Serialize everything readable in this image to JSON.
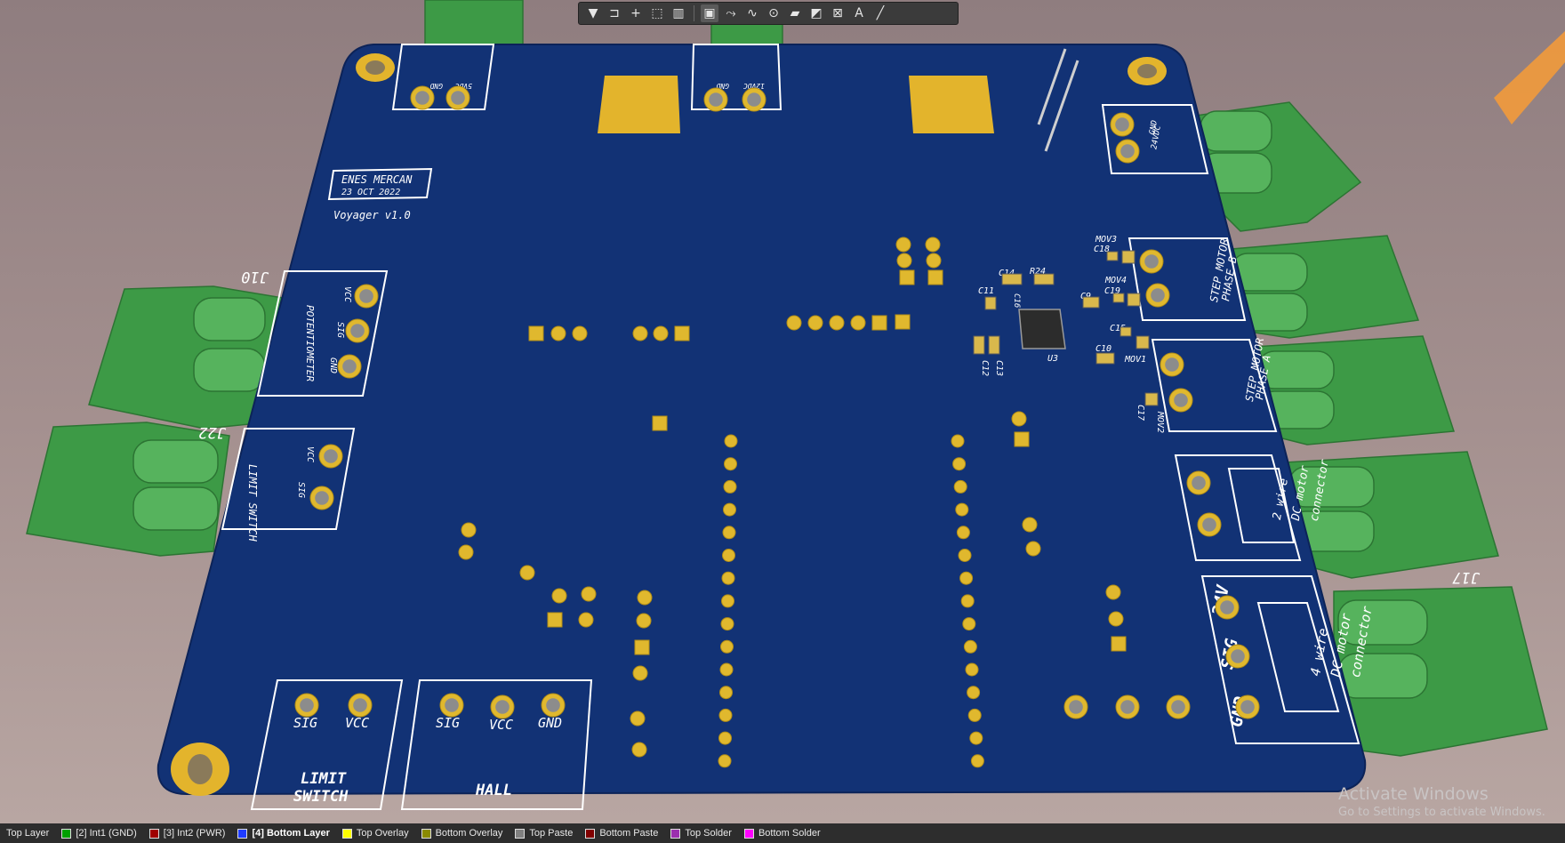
{
  "toolbar": {
    "tools": [
      {
        "name": "filter-tool",
        "glyph": "▼"
      },
      {
        "name": "route-tool",
        "glyph": "⊐"
      },
      {
        "name": "place-cross-tool",
        "glyph": "+"
      },
      {
        "name": "select-area-tool",
        "glyph": "⬚"
      },
      {
        "name": "chart-tool",
        "glyph": "▥"
      },
      {
        "name": "component-tool",
        "glyph": "▣"
      },
      {
        "name": "interactive-routing-tool",
        "glyph": "⤳"
      },
      {
        "name": "differential-pair-tool",
        "glyph": "∿"
      },
      {
        "name": "via-tool",
        "glyph": "⊙"
      },
      {
        "name": "polygon-tool",
        "glyph": "▰"
      },
      {
        "name": "dimension-tool",
        "glyph": "◩"
      },
      {
        "name": "string-frame-tool",
        "glyph": "⊠"
      },
      {
        "name": "text-tool",
        "glyph": "A"
      },
      {
        "name": "line-tool",
        "glyph": "╱"
      }
    ]
  },
  "board": {
    "author": "ENES MERCAN",
    "date": "23 OCT 2022",
    "project": "Voyager v1.0",
    "labels": {
      "potentiometer": "POTENTIOMETER",
      "vcc": "VCC",
      "sig": "SIG",
      "gnd": "GND",
      "limit_switch": "LIMIT SWITCH",
      "limit_line1": "LIMIT",
      "switch_line2": "SWITCH",
      "sw1": "SW1",
      "sw2": "SW2",
      "hall": "HALL",
      "v5": "5VDC",
      "v12": "12VDC",
      "v24": "24VDC",
      "v24_short": "24V",
      "step_b_line1": "STEP MOTOR",
      "step_b_line2": "PHASE B",
      "step_a_line1": "STEP MOTOR",
      "step_a_line2": "PHASE A",
      "fan2": "FAN2",
      "fan1": "FAN1",
      "wire2_1": "2 wire",
      "wire2_2": "DC motor",
      "wire2_3": "connector",
      "wire4_1": "4 wire",
      "wire4_2": "DC motor",
      "wire4_3": "connector"
    },
    "designators": {
      "j10": "J10",
      "j22": "J22",
      "j17": "J17",
      "u3": "U3",
      "c9": "C9",
      "c10": "C10",
      "c11": "C11",
      "c12": "C12",
      "c13": "C13",
      "c14": "C14",
      "c15": "C15",
      "c16": "C16",
      "c17": "C17",
      "c18": "C18",
      "c19": "C19",
      "r24": "R24",
      "mov1": "MOV1",
      "mov2": "MOV2",
      "mov3": "MOV3",
      "mov4": "MOV4"
    }
  },
  "layers": [
    {
      "label": "Top Layer",
      "color": "#cc0000",
      "active": false
    },
    {
      "label": "[2] Int1 (GND)",
      "color": "#00a000",
      "active": false
    },
    {
      "label": "[3] Int2 (PWR)",
      "color": "#a00000",
      "active": false
    },
    {
      "label": "[4] Bottom Layer",
      "color": "#1f3cff",
      "active": true
    },
    {
      "label": "Top Overlay",
      "color": "#ffff00",
      "active": false
    },
    {
      "label": "Bottom Overlay",
      "color": "#8a8a00",
      "active": false
    },
    {
      "label": "Top Paste",
      "color": "#808080",
      "active": false
    },
    {
      "label": "Bottom Paste",
      "color": "#800000",
      "active": false
    },
    {
      "label": "Top Solder",
      "color": "#9b2fae",
      "active": false
    },
    {
      "label": "Bottom Solder",
      "color": "#ff00ff",
      "active": false
    }
  ],
  "watermark": {
    "title": "Activate Windows",
    "subtitle": "Go to Settings to activate Windows."
  }
}
